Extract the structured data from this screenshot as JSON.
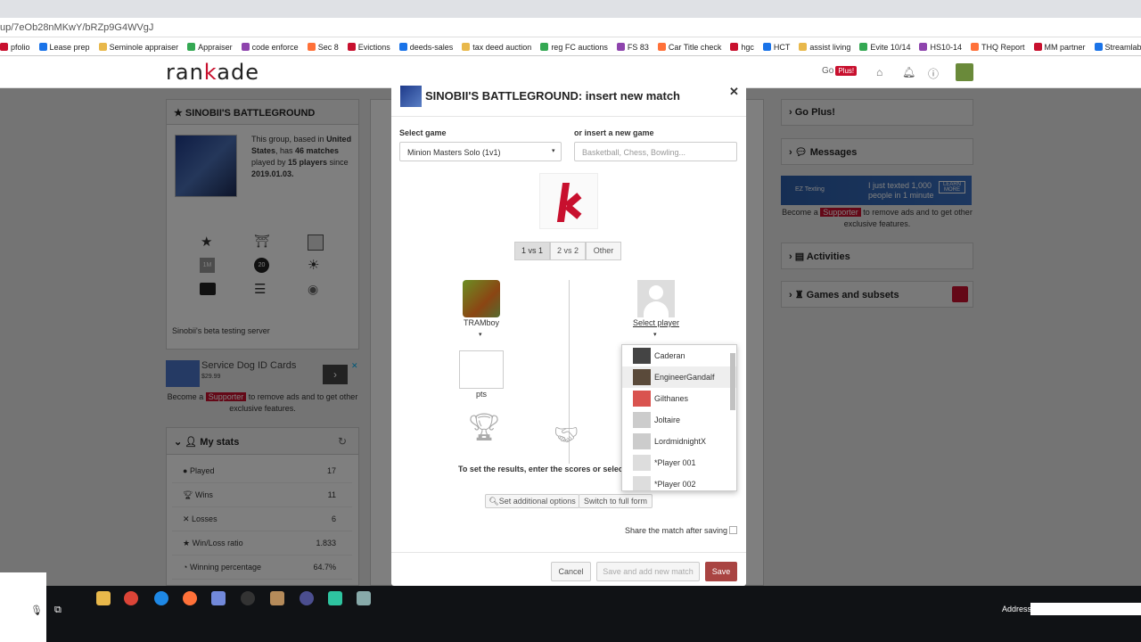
{
  "browser": {
    "url": "up/7eOb28nMKwY/bRZp9G4WVgJ",
    "bookmarks": [
      "pfolio",
      "Lease prep",
      "Seminole appraiser",
      "Appraiser",
      "code enforce",
      "Sec 8",
      "Evictions",
      "deeds-sales",
      "tax deed auction",
      "reg FC auctions",
      "FS 83",
      "Car Title check",
      "hgc",
      "HCT",
      "assist living",
      "Evite 10/14",
      "HS10-14",
      "THQ Report",
      "MM partner",
      "Streamlabs"
    ]
  },
  "header": {
    "logo_pre": "ran",
    "logo_k": "k",
    "logo_post": "ade",
    "go": "Go",
    "plus": "Plus!"
  },
  "group": {
    "title": "SINOBII'S BATTLEGROUND",
    "desc1": "This group, based in ",
    "country": "United States",
    "desc2": ", has ",
    "matches": "46 matches",
    "desc3": " played by ",
    "players": "15 players",
    "desc4": " since ",
    "since": "2019.01.03.",
    "badge_1m": "1M",
    "badge_20": "20",
    "note": "Sinobii's beta testing server"
  },
  "ad_left": {
    "title": "Service Dog ID Cards",
    "price": "$29.99",
    "become": "Become a ",
    "supporter": "Supporter",
    "rest": " to remove ads and to get other exclusive features."
  },
  "mystats": {
    "title": "My stats",
    "rows": [
      {
        "label": "Played",
        "value": "17"
      },
      {
        "label": "Wins",
        "value": "11"
      },
      {
        "label": "Losses",
        "value": "6"
      },
      {
        "label": "Win/Loss ratio",
        "value": "1.833"
      },
      {
        "label": "Winning percentage",
        "value": "64.7%"
      }
    ]
  },
  "right": {
    "goplus": "Go Plus!",
    "messages": "Messages",
    "ad_text1": "I just texted 1,000",
    "ad_text2": "people in 1 minute",
    "ad_learn": "LEARN MORE",
    "ad_brand": "EZ Texting",
    "become": "Become a ",
    "supporter": "Supporter",
    "rest": " to remove ads and to get other exclusive features.",
    "activities": "Activities",
    "games": "Games and subsets"
  },
  "modal": {
    "title": "SINOBII'S BATTLEGROUND: insert new match",
    "select_game_label": "Select game",
    "selected_game": "Minion Masters Solo (1v1)",
    "new_game_label": "or insert a new game",
    "new_game_placeholder": "Basketball, Chess, Bowling...",
    "modes": [
      "1 vs 1",
      "2 vs 2",
      "Other"
    ],
    "player1": "TRAMboy",
    "select_player": "Select player",
    "pts": "pts",
    "instruction": "To set the results, enter the scores or select d",
    "additional": "Set additional options",
    "fullform": "Switch to full form",
    "share": "Share the match after saving",
    "cancel": "Cancel",
    "save_new": "Save and add new match",
    "save": "Save",
    "players": [
      "Caderan",
      "EngineerGandalf",
      "Gilthanes",
      "Joltaire",
      "LordmidnightX",
      "*Player 001",
      "*Player 002"
    ]
  },
  "taskbar": {
    "address_label": "Address"
  },
  "colors": {
    "accent": "#c8102e",
    "save": "#a94442",
    "taskbar": "#101215"
  }
}
